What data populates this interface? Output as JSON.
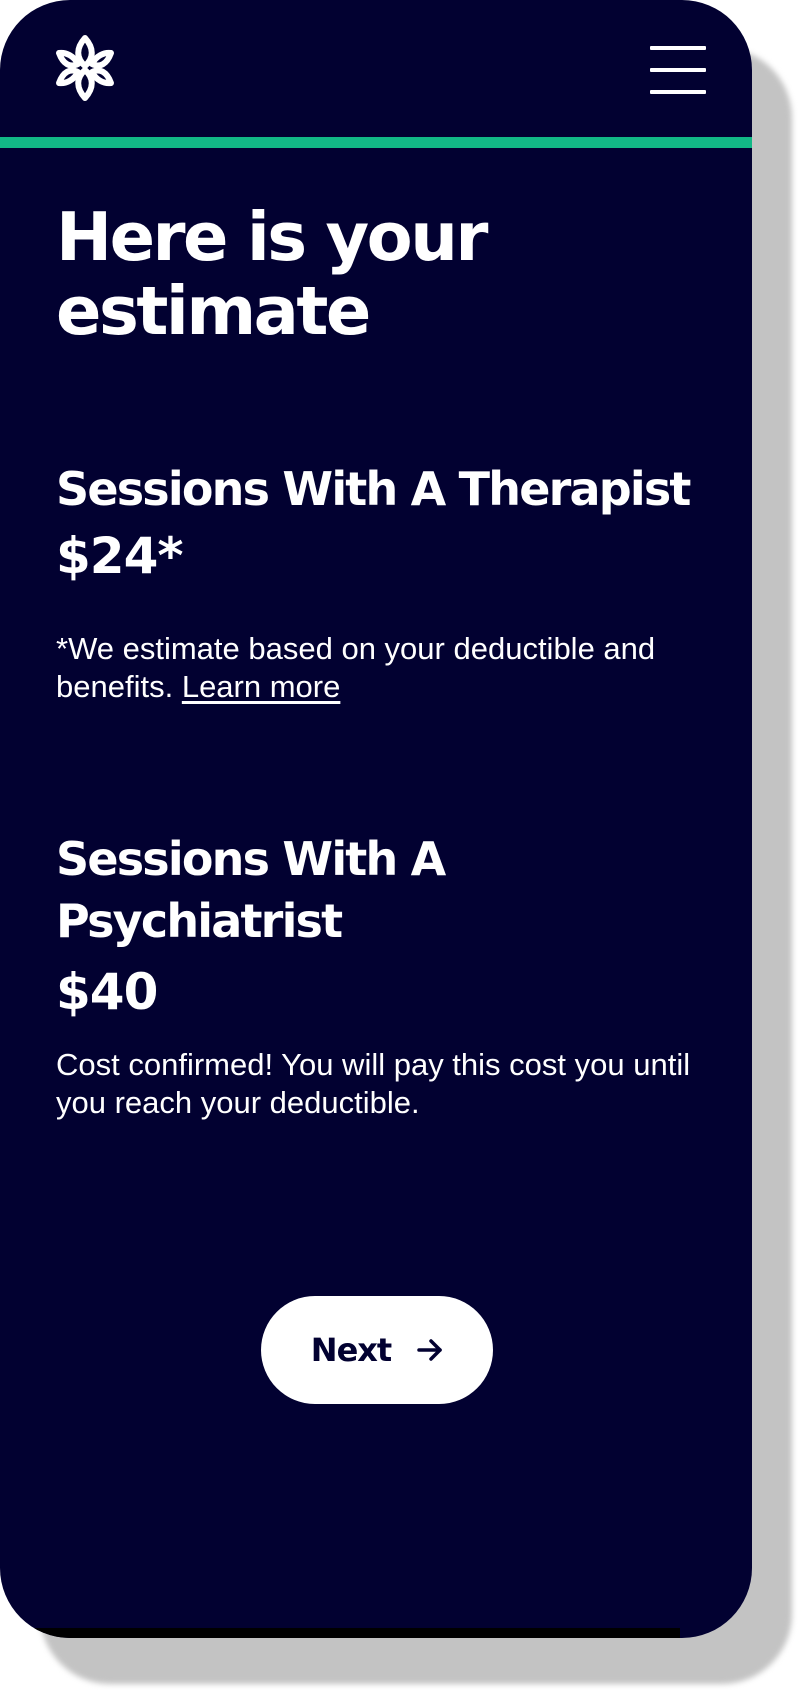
{
  "header": {
    "logo_icon": "lotus-knot-icon",
    "menu_icon": "hamburger-menu-icon",
    "accent_color": "#12b886"
  },
  "page": {
    "title_line1": "Here is your",
    "title_line2": "estimate",
    "background_color": "#020131"
  },
  "sections": [
    {
      "title": "Sessions With A Therapist",
      "price": "$24*",
      "note": "*We estimate based on your deductible and benefits.",
      "link_label": "Learn more"
    },
    {
      "title_line1": "Sessions With A",
      "title_line2": "Psychiatrist",
      "price": "$40",
      "note": "Cost confirmed! You will pay this cost you until you reach your deductible."
    }
  ],
  "actions": {
    "next_label": "Next",
    "next_icon": "arrow-right-icon"
  }
}
